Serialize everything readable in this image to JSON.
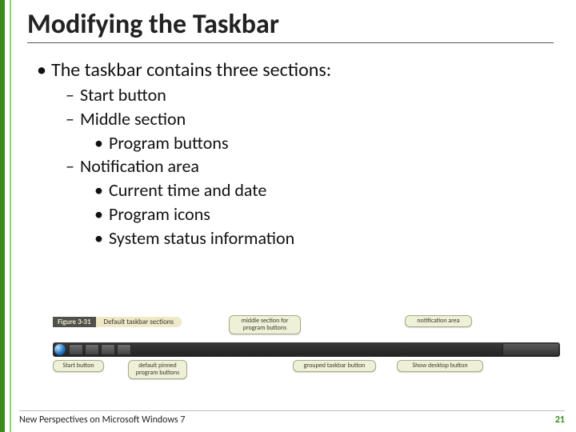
{
  "title": "Modifying the Taskbar",
  "body": {
    "intro": "The taskbar contains three sections:",
    "items": [
      {
        "text": "Start button"
      },
      {
        "text": "Middle section",
        "sub": [
          "Program buttons"
        ]
      },
      {
        "text": "Notification area",
        "sub": [
          "Current time and date",
          "Program icons",
          "System status information"
        ]
      }
    ]
  },
  "figure": {
    "number": "Figure 3-31",
    "caption": "Default taskbar sections",
    "callouts": {
      "start": "Start button",
      "pinned": "default pinned program buttons",
      "middle": "middle section for program buttons",
      "grouped": "grouped taskbar button",
      "notif": "notification area",
      "desktop": "Show desktop button"
    }
  },
  "footer": {
    "left": "New Perspectives on Microsoft Windows 7",
    "page": "21"
  }
}
